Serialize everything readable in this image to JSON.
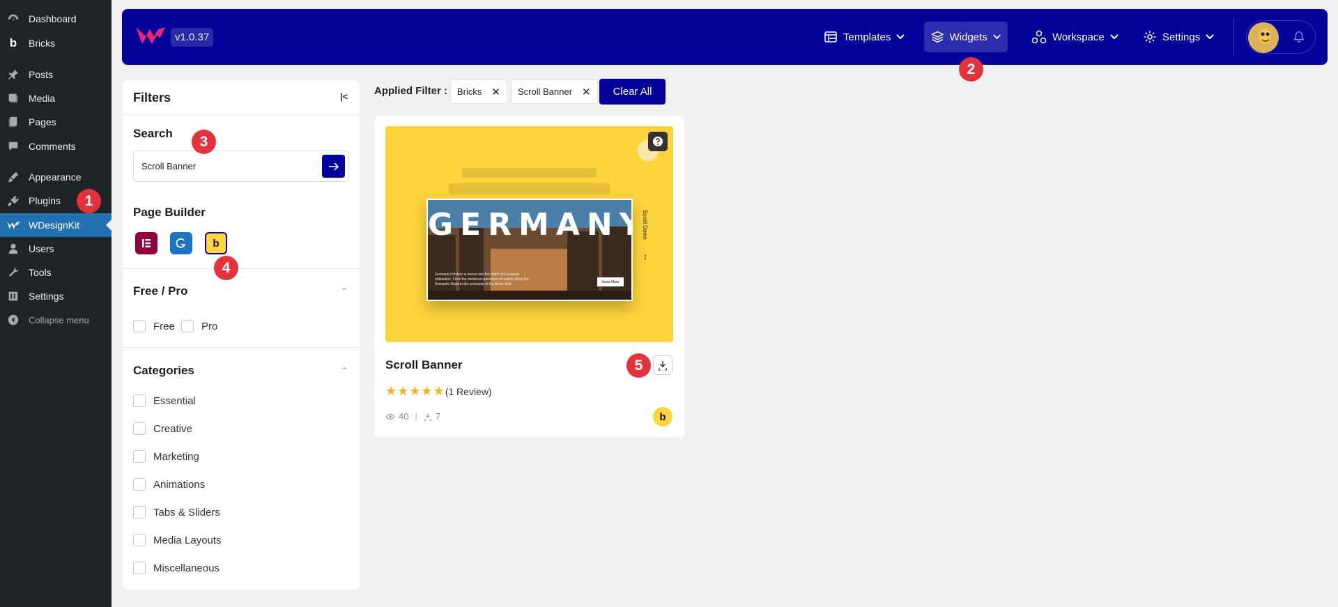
{
  "wp_menu": {
    "items": [
      {
        "label": "Dashboard",
        "icon": "dashboard-icon"
      },
      {
        "label": "Bricks",
        "icon": "bricks-icon"
      },
      {
        "label": "Posts",
        "icon": "pin-icon"
      },
      {
        "label": "Media",
        "icon": "media-icon"
      },
      {
        "label": "Pages",
        "icon": "pages-icon"
      },
      {
        "label": "Comments",
        "icon": "comment-icon"
      },
      {
        "label": "Appearance",
        "icon": "brush-icon"
      },
      {
        "label": "Plugins",
        "icon": "plug-icon"
      },
      {
        "label": "WDesignKit",
        "icon": "wdesignkit-icon"
      },
      {
        "label": "Users",
        "icon": "user-icon"
      },
      {
        "label": "Tools",
        "icon": "wrench-icon"
      },
      {
        "label": "Settings",
        "icon": "settings-icon"
      },
      {
        "label": "Collapse menu",
        "icon": "collapse-icon"
      }
    ]
  },
  "topbar": {
    "version": "v1.0.37",
    "nav": [
      {
        "label": "Templates",
        "icon": "templates-icon"
      },
      {
        "label": "Widgets",
        "icon": "layers-icon"
      },
      {
        "label": "Workspace",
        "icon": "workspace-icon"
      },
      {
        "label": "Settings",
        "icon": "gear-icon"
      }
    ]
  },
  "filters": {
    "title": "Filters",
    "search": {
      "heading": "Search",
      "value": "Scroll Banner"
    },
    "page_builder": {
      "heading": "Page Builder",
      "builders": [
        "elementor",
        "gutenberg",
        "bricks"
      ]
    },
    "free_pro": {
      "heading": "Free / Pro",
      "options": [
        "Free",
        "Pro"
      ]
    },
    "categories": {
      "heading": "Categories",
      "options": [
        "Essential",
        "Creative",
        "Marketing",
        "Animations",
        "Tabs & Sliders",
        "Media Layouts",
        "Miscellaneous"
      ]
    }
  },
  "applied": {
    "label": "Applied Filter :",
    "chips": [
      "Bricks",
      "Scroll Banner"
    ],
    "clear_label": "Clear All"
  },
  "card": {
    "title": "Scroll Banner",
    "rating": 5,
    "review_label": "(1 Review)",
    "views": "40",
    "downloads": "7",
    "preview": {
      "headline": "GERMANY",
      "body": "Germany's history is woven into the fabric of European civilization. From the medieval splendour of castles along the Romantic Road to the remnants of the Berlin Wall.",
      "button": "Know More",
      "scroll_label": "Scroll Down"
    }
  },
  "markers": [
    "1",
    "2",
    "3",
    "4",
    "5"
  ],
  "colors": {
    "primary": "#03039a",
    "accent": "#e4323d",
    "bricks_yellow": "#ffd53d",
    "wp_active": "#2271b1"
  }
}
